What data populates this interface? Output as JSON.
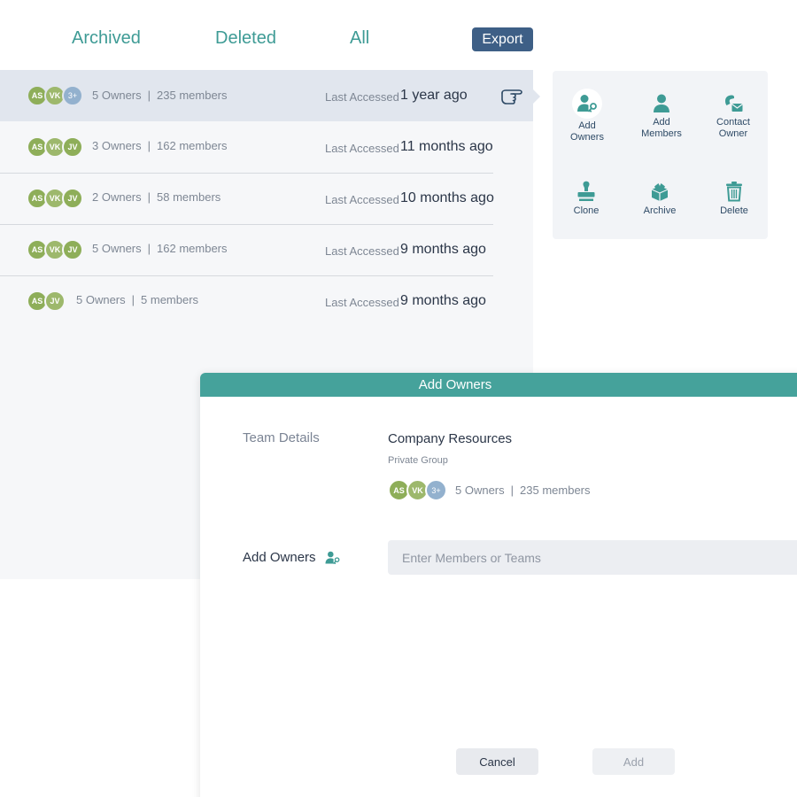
{
  "tabs": {
    "archived": "Archived",
    "deleted": "Deleted",
    "all": "All"
  },
  "export_label": "Export",
  "rows": [
    {
      "avatars": [
        "AS",
        "VK",
        "3+"
      ],
      "owners": "5 Owners",
      "members": "235 members",
      "last_label": "Last Accessed",
      "last_value": "1 year ago"
    },
    {
      "avatars": [
        "AS",
        "VK",
        "JV"
      ],
      "owners": "3 Owners",
      "members": "162 members",
      "last_label": "Last Accessed",
      "last_value": "11 months ago"
    },
    {
      "avatars": [
        "AS",
        "VK",
        "JV"
      ],
      "owners": "2 Owners",
      "members": "58 members",
      "last_label": "Last Accessed",
      "last_value": "10 months ago"
    },
    {
      "avatars": [
        "AS",
        "VK",
        "JV"
      ],
      "owners": "5 Owners",
      "members": "162 members",
      "last_label": "Last Accessed",
      "last_value": "9 months ago"
    },
    {
      "avatars": [
        "AS",
        "JV"
      ],
      "owners": "5 Owners",
      "members": "5 members",
      "last_label": "Last Accessed",
      "last_value": "9 months ago"
    }
  ],
  "separator": "|",
  "actions": {
    "add_owners": [
      "Add",
      "Owners"
    ],
    "add_members": [
      "Add",
      "Members"
    ],
    "contact_owner": [
      "Contact",
      "Owner"
    ],
    "clone": "Clone",
    "archive": "Archive",
    "delete": "Delete"
  },
  "modal": {
    "title": "Add Owners",
    "team_details_label": "Team Details",
    "team_name": "Company Resources",
    "team_type": "Private Group",
    "avatars": [
      "AS",
      "VK",
      "3+"
    ],
    "owners": "5 Owners",
    "members": "235 members",
    "add_owners_label": "Add Owners",
    "input_placeholder": "Enter Members or Teams",
    "cancel_label": "Cancel",
    "add_label": "Add"
  },
  "colors": {
    "accent": "#3e9b95",
    "header": "#45a29b",
    "export": "#3e5f86",
    "avatar_green": "#8eae59",
    "avatar_blue": "#93b1ce"
  }
}
